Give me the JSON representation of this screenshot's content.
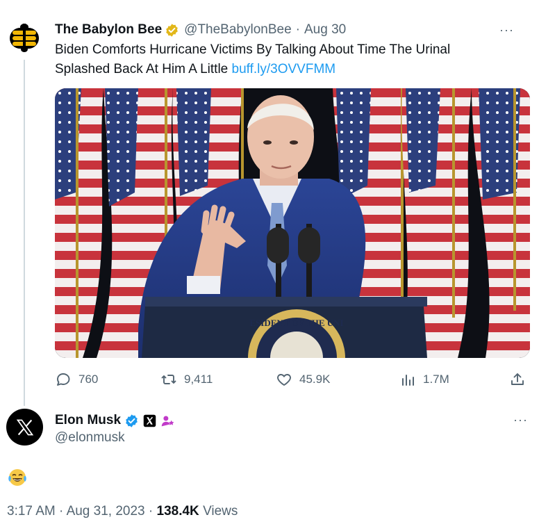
{
  "quoted_tweet": {
    "author_name": "The Babylon Bee",
    "author_handle": "@TheBabylonBee",
    "separator": "·",
    "date": "Aug 30",
    "text": "Biden Comforts Hurricane Victims By Talking About Time The Urinal Splashed Back At Him A Little",
    "link_text": "buff.ly/3OVVFMM",
    "more_label": "···",
    "stats": {
      "replies": "760",
      "reposts": "9,411",
      "likes": "45.9K",
      "views": "1.7M"
    },
    "badge_color": "#e2b719",
    "podium_seal_text": "ESIDENT OF THE UNI"
  },
  "main_tweet": {
    "author_name": "Elon Musk",
    "author_handle": "@elonmusk",
    "more_label": "···",
    "body_emoji": "😂",
    "time": "3:17 AM",
    "separator1": "·",
    "date": "Aug 31, 2023",
    "separator2": "·",
    "views_count": "138.4K",
    "views_label": "Views",
    "badge_color": "#1d9bf0"
  },
  "colors": {
    "link": "#1d9bf0",
    "muted": "#536471",
    "text": "#0f1419",
    "thread_line": "#cfd9de"
  }
}
